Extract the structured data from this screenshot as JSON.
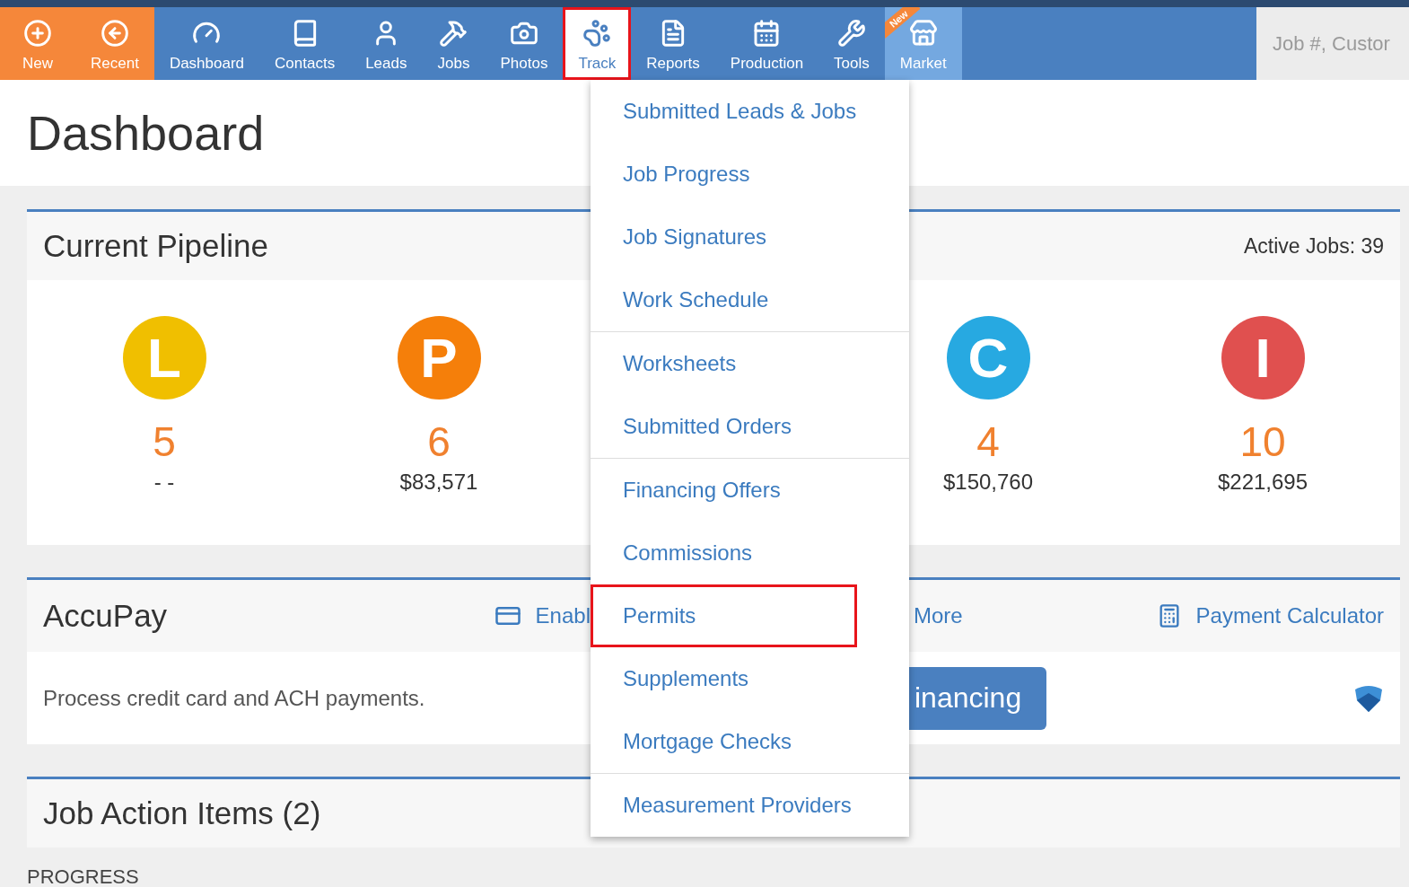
{
  "nav": {
    "items": [
      {
        "label": "New",
        "selected": false,
        "highlighted": false
      },
      {
        "label": "Recent",
        "selected": false,
        "highlighted": false
      },
      {
        "label": "Dashboard",
        "selected": false,
        "highlighted": false
      },
      {
        "label": "Contacts",
        "selected": false,
        "highlighted": false
      },
      {
        "label": "Leads",
        "selected": false,
        "highlighted": false
      },
      {
        "label": "Jobs",
        "selected": false,
        "highlighted": false
      },
      {
        "label": "Photos",
        "selected": false,
        "highlighted": false
      },
      {
        "label": "Track",
        "selected": true,
        "highlighted": true
      },
      {
        "label": "Reports",
        "selected": false,
        "highlighted": false
      },
      {
        "label": "Production",
        "selected": false,
        "highlighted": false
      },
      {
        "label": "Tools",
        "selected": false,
        "highlighted": false
      },
      {
        "label": "Market",
        "selected": false,
        "highlighted": false,
        "badge": "New"
      }
    ],
    "search": {
      "placeholder": "Job #, Custor"
    }
  },
  "page_title": "Dashboard",
  "pipeline": {
    "title": "Current Pipeline",
    "active_jobs": "Active Jobs: 39",
    "stages": [
      {
        "letter": "L",
        "color": "#f0bf00",
        "count": "5",
        "amount": "- -"
      },
      {
        "letter": "P",
        "color": "#f57f0a",
        "count": "6",
        "amount": "$83,571"
      },
      {
        "letter": "C",
        "color": "#27a9e1",
        "count": "4",
        "amount": "$150,760"
      },
      {
        "letter": "I",
        "color": "#e0504f",
        "count": "10",
        "amount": "$221,695"
      }
    ]
  },
  "accupay": {
    "title": "AccuPay",
    "enable_link": "Enabl",
    "more_link": "More",
    "calculator_link": "Payment Calculator",
    "description": "Process credit card and ACH payments.",
    "financing_button": "inancing"
  },
  "job_action": {
    "title": "Job Action Items (2)",
    "section_label": "PROGRESS"
  },
  "track_menu": {
    "groups": [
      {
        "items": [
          {
            "label": "Submitted Leads & Jobs",
            "highlighted": false
          },
          {
            "label": "Job Progress",
            "highlighted": false
          },
          {
            "label": "Job Signatures",
            "highlighted": false
          },
          {
            "label": "Work Schedule",
            "highlighted": false
          }
        ]
      },
      {
        "items": [
          {
            "label": "Worksheets",
            "highlighted": false
          },
          {
            "label": "Submitted Orders",
            "highlighted": false
          }
        ]
      },
      {
        "items": [
          {
            "label": "Financing Offers",
            "highlighted": false
          },
          {
            "label": "Commissions",
            "highlighted": false
          },
          {
            "label": "Permits",
            "highlighted": true
          },
          {
            "label": "Supplements",
            "highlighted": false
          },
          {
            "label": "Mortgage Checks",
            "highlighted": false
          }
        ]
      },
      {
        "items": [
          {
            "label": "Measurement Providers",
            "highlighted": false
          }
        ]
      }
    ]
  }
}
